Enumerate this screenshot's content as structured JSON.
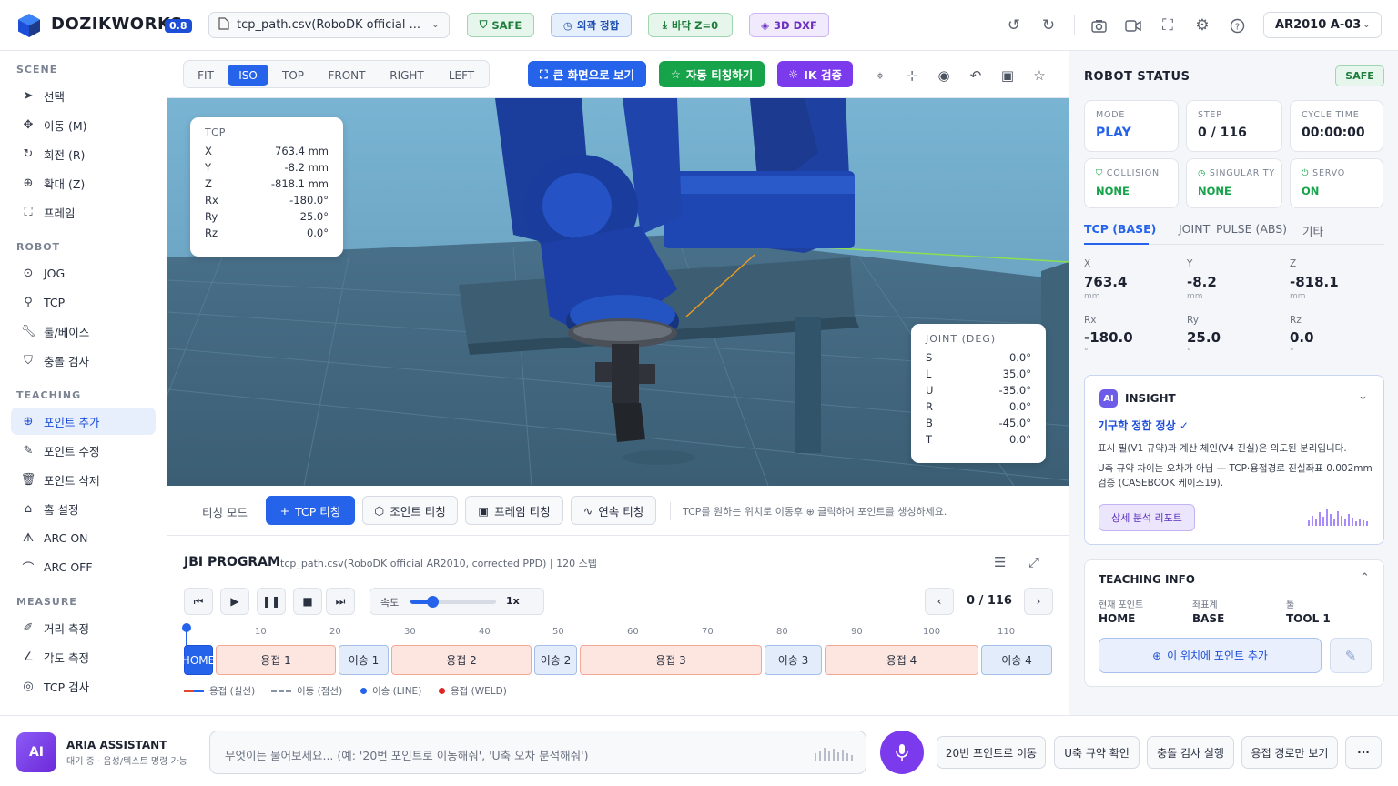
{
  "app": {
    "brand": "DOZIKWORKS",
    "version": "0.8"
  },
  "topbar": {
    "file": "tcp_path.csv(RoboDK official ...",
    "badges": {
      "safe": "SAFE",
      "coord": "외곽 정합",
      "floor": "바닥 Z=0",
      "dxf": "3D DXF"
    },
    "robot": "AR2010 A-03"
  },
  "sidebar": {
    "scene_label": "SCENE",
    "scene": [
      "선택",
      "이동 (M)",
      "회전 (R)",
      "확대 (Z)",
      "프레임"
    ],
    "robot_label": "ROBOT",
    "robot": [
      "JOG",
      "TCP",
      "툴/베이스",
      "충돌 검사"
    ],
    "teaching_label": "TEACHING",
    "teaching": [
      "포인트 추가",
      "포인트 수정",
      "포인트 삭제",
      "홈 설정",
      "ARC ON",
      "ARC OFF"
    ],
    "measure_label": "MEASURE",
    "measure": [
      "거리 측정",
      "각도 측정",
      "TCP 검사"
    ]
  },
  "viewport": {
    "views": [
      "FIT",
      "ISO",
      "TOP",
      "FRONT",
      "RIGHT",
      "LEFT"
    ],
    "actions": {
      "fullscreen": "큰 화면으로 보기",
      "auto_teach": "자동 티칭하기",
      "ik": "IK 검증"
    },
    "tcp_panel": {
      "title": "TCP",
      "rows": [
        {
          "k": "X",
          "v": "763.4 mm"
        },
        {
          "k": "Y",
          "v": "-8.2 mm"
        },
        {
          "k": "Z",
          "v": "-818.1 mm"
        },
        {
          "k": "Rx",
          "v": "-180.0°"
        },
        {
          "k": "Ry",
          "v": "25.0°"
        },
        {
          "k": "Rz",
          "v": "0.0°"
        }
      ]
    },
    "joint_panel": {
      "title": "JOINT (DEG)",
      "rows": [
        {
          "k": "S",
          "v": "0.0°"
        },
        {
          "k": "L",
          "v": "35.0°"
        },
        {
          "k": "U",
          "v": "-35.0°"
        },
        {
          "k": "R",
          "v": "0.0°"
        },
        {
          "k": "B",
          "v": "-45.0°"
        },
        {
          "k": "T",
          "v": "0.0°"
        }
      ]
    }
  },
  "teach": {
    "mode_label": "티칭 모드",
    "buttons": [
      "TCP 티칭",
      "조인트 티칭",
      "프레임 티칭",
      "연속 티칭"
    ],
    "hint": "TCP를 원하는 위치로 이동후 ⊕ 클릭하여 포인트를 생성하세요."
  },
  "program": {
    "title": "JBI PROGRAM",
    "subtitle": "tcp_path.csv(RoboDK official AR2010, corrected PPD) | 120 스텝",
    "speed_label": "속도",
    "speed_value": "1x",
    "speed_fraction": 0.26,
    "counter": "0 / 116",
    "ticks": [
      "10",
      "20",
      "30",
      "40",
      "50",
      "60",
      "70",
      "80",
      "90",
      "100",
      "110"
    ],
    "segments": [
      {
        "label": "HOME",
        "type": "home"
      },
      {
        "label": "용접 1",
        "type": "weld"
      },
      {
        "label": "이송 1",
        "type": "move"
      },
      {
        "label": "용접 2",
        "type": "weld"
      },
      {
        "label": "이송 2",
        "type": "move"
      },
      {
        "label": "용접 3",
        "type": "weld"
      },
      {
        "label": "이송 3",
        "type": "move"
      },
      {
        "label": "용접 4",
        "type": "weld"
      },
      {
        "label": "이송 4",
        "type": "move"
      }
    ],
    "legend": [
      "용접 (실선)",
      "이동 (점선)",
      "이송 (LINE)",
      "용접 (WELD)"
    ]
  },
  "robot_status": {
    "title": "ROBOT STATUS",
    "badge": "SAFE",
    "cards": [
      {
        "label": "MODE",
        "value": "PLAY"
      },
      {
        "label": "STEP",
        "value": "0 / 116"
      },
      {
        "label": "CYCLE TIME",
        "value": "00:00:00"
      },
      {
        "label": "COLLISION",
        "value": "NONE"
      },
      {
        "label": "SINGULARITY",
        "value": "NONE"
      },
      {
        "label": "SERVO",
        "value": "ON"
      }
    ],
    "tabs": [
      "TCP (BASE)",
      "JOINT",
      "PULSE (ABS)",
      "기타"
    ],
    "coords": [
      {
        "k": "X",
        "v": "763.4",
        "u": "mm"
      },
      {
        "k": "Y",
        "v": "-8.2",
        "u": "mm"
      },
      {
        "k": "Z",
        "v": "-818.1",
        "u": "mm"
      },
      {
        "k": "Rx",
        "v": "-180.0",
        "u": "°"
      },
      {
        "k": "Ry",
        "v": "25.0",
        "u": "°"
      },
      {
        "k": "Rz",
        "v": "0.0",
        "u": "°"
      }
    ]
  },
  "insight": {
    "badge": "AI",
    "title": "INSIGHT",
    "headline": "기구학 정합 정상 ✓",
    "p1": "표시 필(V1 규약)과 계산 체인(V4 진실)은 의도된 분리입니다.",
    "p2": "U축 규약 차이는 오차가 아님 — TCP·용접경로 진실좌표 0.002mm 검증 (CASEBOOK 케이스19).",
    "report": "상세 분석 리포트"
  },
  "teaching_info": {
    "title": "TEACHING INFO",
    "cols": [
      {
        "k": "현재 포인트",
        "v": "HOME"
      },
      {
        "k": "좌표계",
        "v": "BASE"
      },
      {
        "k": "툴",
        "v": "TOOL 1"
      }
    ],
    "add_btn": "이 위치에 포인트 추가"
  },
  "assistant": {
    "avatar": "AI",
    "name": "ARIA ASSISTANT",
    "status": "대기 중 · 음성/텍스트 명령 가능",
    "placeholder": "무엇이든 물어보세요... (예: '20번 포인트로 이동해줘', 'U축 오차 분석해줘')",
    "quick": [
      "20번 포인트로 이동",
      "U축 규약 확인",
      "충돌 검사 실행",
      "용접 경로만 보기"
    ],
    "more": "···"
  },
  "colors": {
    "primary": "#2563eb",
    "green": "#16a34a",
    "purple": "#7c3aed",
    "weld": "#e0492d",
    "move": "#2563eb"
  }
}
